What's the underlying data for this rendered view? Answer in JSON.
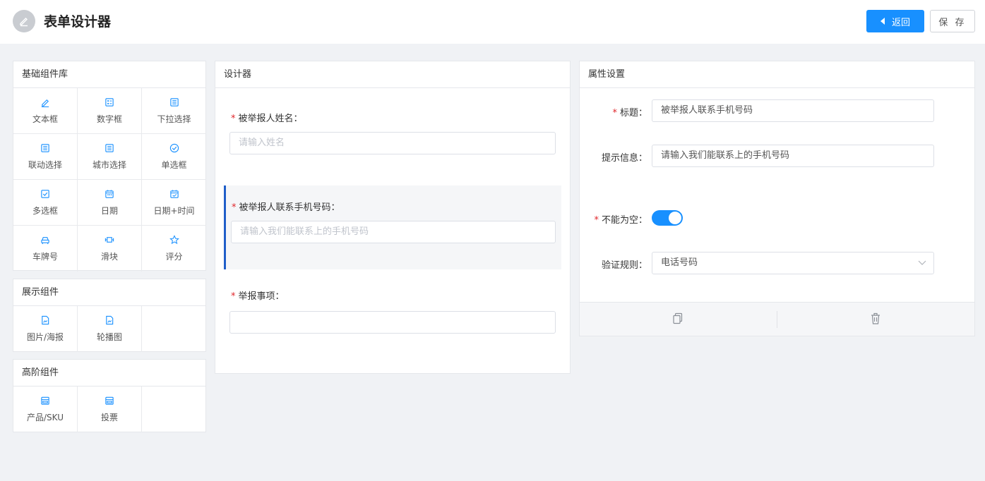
{
  "header": {
    "title": "表单设计器",
    "back_label": "返回",
    "save_label": "保 存"
  },
  "library": {
    "basic": {
      "title": "基础组件库",
      "items": [
        {
          "label": "文本框",
          "icon": "pencil-icon"
        },
        {
          "label": "数字框",
          "icon": "number-icon"
        },
        {
          "label": "下拉选择",
          "icon": "list-icon"
        },
        {
          "label": "联动选择",
          "icon": "list-icon"
        },
        {
          "label": "城市选择",
          "icon": "list-icon"
        },
        {
          "label": "单选框",
          "icon": "radio-check-icon"
        },
        {
          "label": "多选框",
          "icon": "checkbox-icon"
        },
        {
          "label": "日期",
          "icon": "calendar-icon"
        },
        {
          "label": "日期+时间",
          "icon": "calendar-time-icon"
        },
        {
          "label": "车牌号",
          "icon": "car-icon"
        },
        {
          "label": "滑块",
          "icon": "slider-icon"
        },
        {
          "label": "评分",
          "icon": "star-icon"
        }
      ]
    },
    "display": {
      "title": "展示组件",
      "items": [
        {
          "label": "图片/海报",
          "icon": "image-file-icon"
        },
        {
          "label": "轮播图",
          "icon": "image-file-icon"
        }
      ]
    },
    "advanced": {
      "title": "高阶组件",
      "items": [
        {
          "label": "产品/SKU",
          "icon": "store-icon"
        },
        {
          "label": "投票",
          "icon": "store-icon"
        }
      ]
    }
  },
  "designer": {
    "title": "设计器",
    "fields": [
      {
        "label": "被举报人姓名：",
        "placeholder": "请输入姓名",
        "required": "*"
      },
      {
        "label": "被举报人联系手机号码：",
        "placeholder": "请输入我们能联系上的手机号码",
        "required": "*"
      },
      {
        "label": "举报事项：",
        "placeholder": "",
        "required": "*"
      }
    ]
  },
  "properties": {
    "title": "属性设置",
    "title_label": "标题：",
    "title_value": "被举报人联系手机号码",
    "hint_label": "提示信息：",
    "hint_value": "请输入我们能联系上的手机号码",
    "required_label": "不能为空：",
    "required_mark": "*",
    "required_on": true,
    "rule_label": "验证规则：",
    "rule_value": "电话号码"
  },
  "colors": {
    "accent": "#1890ff",
    "required": "#e0262b",
    "selected_border": "#1f5ec9"
  }
}
